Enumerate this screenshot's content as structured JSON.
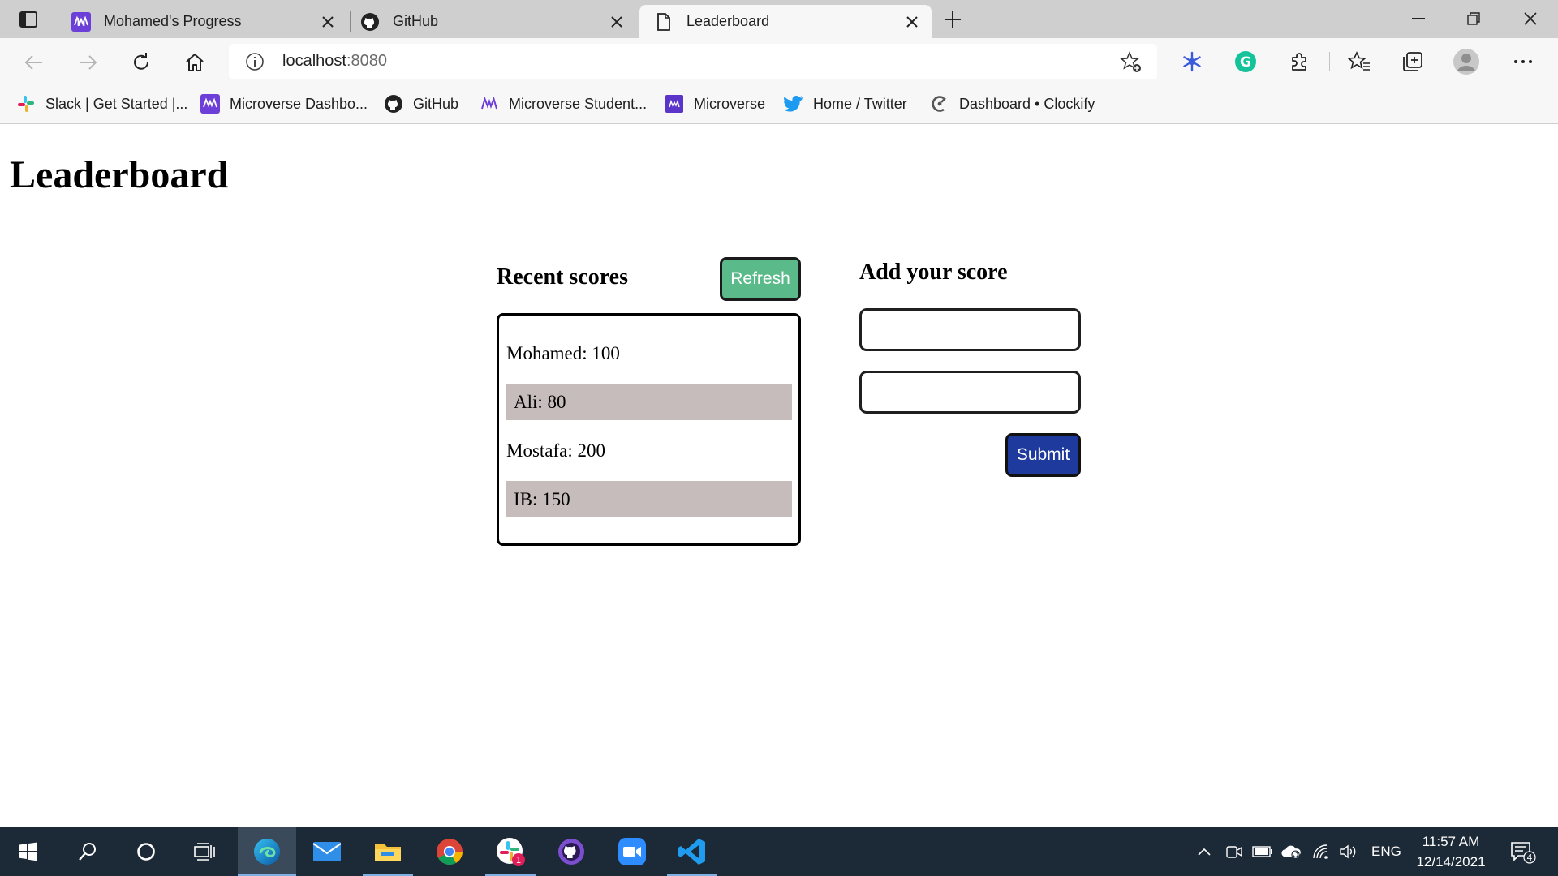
{
  "browser": {
    "tabs": [
      {
        "title": "Mohamed's Progress",
        "icon": "microverse-icon",
        "active": false
      },
      {
        "title": "GitHub",
        "icon": "github-icon",
        "active": false
      },
      {
        "title": "Leaderboard",
        "icon": "page-icon",
        "active": true
      }
    ],
    "address": {
      "host": "localhost",
      "port": ":8080"
    },
    "favorites": [
      {
        "label": "Slack | Get Started |...",
        "icon": "slack-icon"
      },
      {
        "label": "Microverse Dashbo...",
        "icon": "microverse-icon"
      },
      {
        "label": "GitHub",
        "icon": "github-icon"
      },
      {
        "label": "Microverse Student...",
        "icon": "microverse-outline-icon"
      },
      {
        "label": "Microverse",
        "icon": "microverse-small-icon"
      },
      {
        "label": "Home / Twitter",
        "icon": "twitter-icon"
      },
      {
        "label": "Dashboard • Clockify",
        "icon": "clockify-icon"
      }
    ],
    "extensions": [
      "snowflake-extension-icon",
      "grammarly-icon",
      "extensions-puzzle-icon",
      "favorites-icon",
      "collections-icon",
      "profile-avatar",
      "more-options-icon"
    ]
  },
  "page": {
    "title": "Leaderboard",
    "recent": {
      "title": "Recent scores",
      "refresh_label": "Refresh",
      "scores": [
        "Mohamed: 100",
        "Ali: 80",
        "Mostafa: 200",
        "IB: 150"
      ]
    },
    "add": {
      "title": "Add your score",
      "name_value": "",
      "score_value": "",
      "submit_label": "Submit"
    }
  },
  "taskbar": {
    "apps": [
      "windows-start-icon",
      "search-icon",
      "cortana-icon",
      "task-view-icon",
      "edge-icon",
      "mail-icon",
      "file-explorer-icon",
      "chrome-icon",
      "slack-icon",
      "github-desktop-icon",
      "zoom-icon",
      "vscode-icon"
    ],
    "slack_badge": "1",
    "language": "ENG",
    "time": "11:57 AM",
    "date": "12/14/2021",
    "notification_count": "4"
  },
  "colors": {
    "refresh_bg": "#5aba8a",
    "submit_bg": "#1e3a9c",
    "row_shade": "#c6bcbb",
    "taskbar_bg": "#1c2936"
  }
}
